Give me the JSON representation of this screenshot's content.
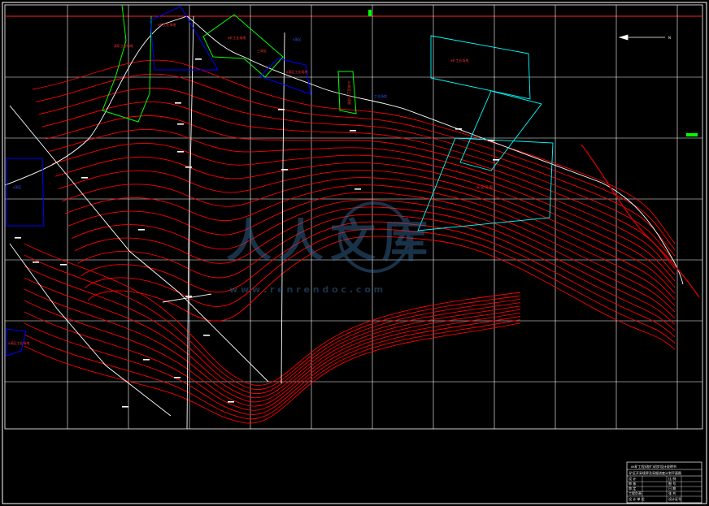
{
  "watermark": {
    "brand_text": "人人文库",
    "url": "w w w . r e n r e n d o c . c o m"
  },
  "title_block": {
    "heading": "xx矿工程(改扩)初步设计说明书",
    "subtitle": "矿区开采境界及采掘进度计划平面图",
    "rows": [
      "设 计",
      "审 核",
      "审 定",
      "工程负责",
      "设 计 单 位"
    ],
    "right_rows": [
      "比 例",
      "图 号",
      "日 期",
      "张 共",
      "设计证号"
    ]
  },
  "zone_labels": {
    "z1": "采矿工业场地",
    "z2": "x矿工业场地",
    "z3": "x矿工业场地",
    "z4": "三采区",
    "z5": "x采区工业场地",
    "z6": "x采区",
    "z7": "x矿工业场地",
    "z8": "工业场地",
    "z9": "xx采区工业场地",
    "z10": "采 区 范 围",
    "z11": "x采区",
    "z12": "x采区工业场地"
  },
  "north_arrow_label": "N",
  "colors": {
    "background": "#000000",
    "grid": "#ffffff",
    "contour": "#ff0000",
    "boundary_blue": "#0000ff",
    "boundary_green": "#00ff00",
    "boundary_cyan": "#00ffff",
    "road": "#ffffff",
    "river": "#cc0000"
  }
}
